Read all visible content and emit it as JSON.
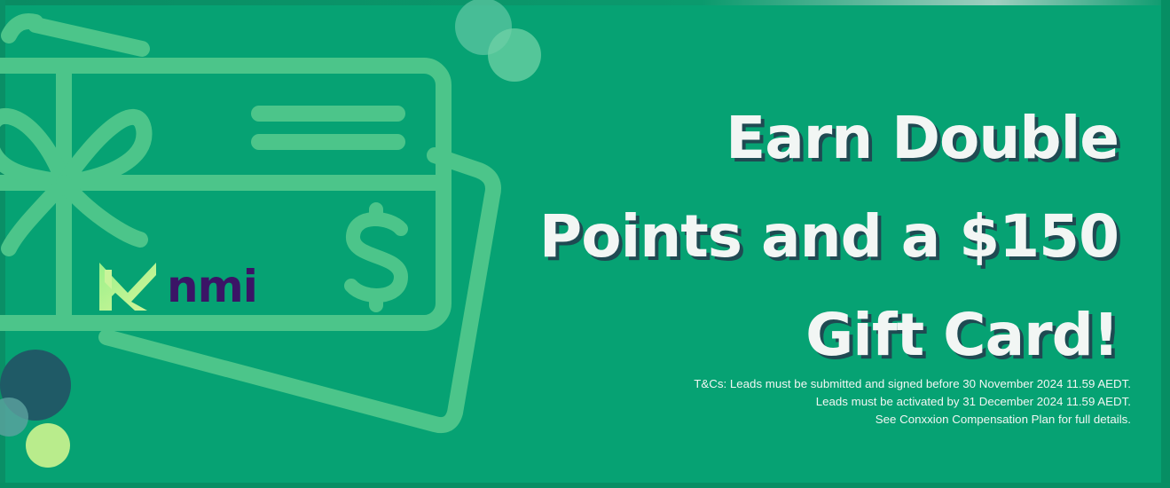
{
  "banner": {
    "headline": [
      "Earn Double",
      "Points and a $150",
      "Gift Card!"
    ],
    "terms": [
      "T&Cs: Leads must be submitted and signed before 30 November 2024 11.59 AEDT.",
      "Leads must be activated by 31 December 2024 11.59 AEDT.",
      "See Conxxion Compensation Plan for full details."
    ],
    "logo_text": "nmi",
    "icons": {
      "gift_card": "gift-card-icon",
      "dollar": "dollar-sign-icon",
      "logo_mark": "nmi-logo-mark"
    },
    "colors": {
      "background": "#06a273",
      "line_art": "#4cc58a",
      "headline": "#f2f6f4",
      "headline_shadow": "#1f4a52",
      "logo_text": "#3b1466",
      "dark_circle": "#1f5a66",
      "light_circle": "#b9ec8c"
    }
  }
}
